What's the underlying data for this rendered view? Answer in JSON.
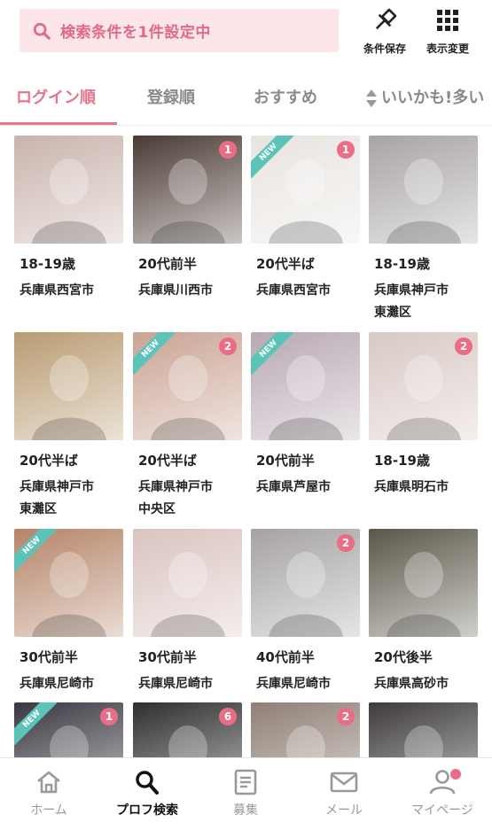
{
  "search": {
    "label": "検索条件を1件設定中"
  },
  "header_actions": [
    {
      "label": "条件保存",
      "icon": "pin-icon"
    },
    {
      "label": "表示変更",
      "icon": "grid-icon"
    }
  ],
  "tabs": [
    {
      "label": "ログイン順",
      "active": true
    },
    {
      "label": "登録順",
      "active": false
    },
    {
      "label": "おすすめ",
      "active": false
    },
    {
      "label": "いいかも!多い",
      "active": false
    }
  ],
  "profiles": [
    {
      "age": "18-19歳",
      "location": "兵庫県西宮市",
      "badge": "",
      "new": false,
      "color": "#c9b3ac"
    },
    {
      "age": "20代前半",
      "location": "兵庫県川西市",
      "badge": "1",
      "new": false,
      "color": "#4a3a34"
    },
    {
      "age": "20代半ば",
      "location": "兵庫県西宮市",
      "badge": "1",
      "new": true,
      "color": "#e8e4e0"
    },
    {
      "age": "18-19歳",
      "location": "兵庫県神戸市",
      "location2": "東灘区",
      "badge": "",
      "new": false,
      "color": "#a8a3a6"
    },
    {
      "age": "20代半ば",
      "location": "兵庫県神戸市",
      "location2": "東灘区",
      "badge": "",
      "new": false,
      "color": "#b99b72"
    },
    {
      "age": "20代半ば",
      "location": "兵庫県神戸市",
      "location2": "中央区",
      "badge": "2",
      "new": true,
      "color": "#caa393"
    },
    {
      "age": "20代前半",
      "location": "兵庫県芦屋市",
      "badge": "",
      "new": true,
      "color": "#b8a8b3"
    },
    {
      "age": "18-19歳",
      "location": "兵庫県明石市",
      "badge": "2",
      "new": false,
      "color": "#d8c8c4"
    },
    {
      "age": "30代前半",
      "location": "兵庫県尼崎市",
      "badge": "",
      "new": true,
      "color": "#b58468"
    },
    {
      "age": "30代前半",
      "location": "兵庫県尼崎市",
      "badge": "",
      "new": false,
      "color": "#d9c3bf"
    },
    {
      "age": "40代前半",
      "location": "兵庫県尼崎市",
      "badge": "2",
      "new": false,
      "color": "#a6a2a3"
    },
    {
      "age": "20代後半",
      "location": "兵庫県高砂市",
      "badge": "",
      "new": false,
      "color": "#5a5648"
    },
    {
      "age": "",
      "location": "",
      "badge": "1",
      "new": true,
      "color": "#3a3640"
    },
    {
      "age": "",
      "location": "",
      "badge": "6",
      "new": false,
      "color": "#2e2e2e"
    },
    {
      "age": "",
      "location": "",
      "badge": "2",
      "new": false,
      "color": "#8f7f75"
    },
    {
      "age": "",
      "location": "",
      "badge": "",
      "new": false,
      "color": "#3e3a3a"
    }
  ],
  "new_label": "NEW",
  "bottom_nav": [
    {
      "label": "ホーム",
      "icon": "home-icon",
      "active": false
    },
    {
      "label": "プロフ検索",
      "icon": "search-icon",
      "active": true
    },
    {
      "label": "募集",
      "icon": "document-icon",
      "active": false
    },
    {
      "label": "メール",
      "icon": "mail-icon",
      "active": false
    },
    {
      "label": "マイページ",
      "icon": "user-icon",
      "active": false
    }
  ],
  "colors": {
    "accent": "#e8738a",
    "badge": "#ea6c86",
    "new_ribbon": "#5bc4b8",
    "search_bg": "#fde6ea"
  }
}
